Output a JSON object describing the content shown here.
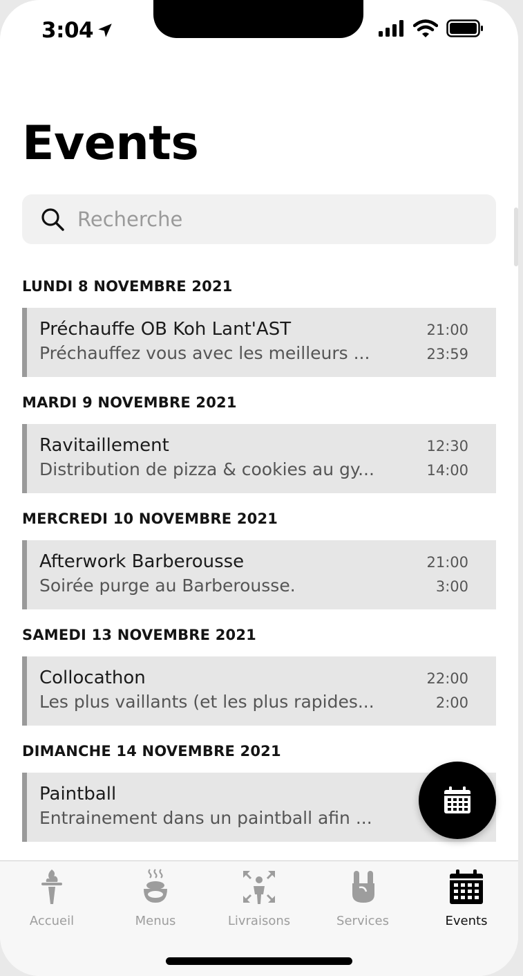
{
  "status_bar": {
    "time": "3:04"
  },
  "page": {
    "title": "Events"
  },
  "search": {
    "placeholder": "Recherche"
  },
  "sections": [
    {
      "date": "LUNDI 8 NOVEMBRE 2021",
      "event": {
        "title": "Préchauffe OB Koh Lant'AST",
        "description": "Préchauffez vous avec les meilleurs ...",
        "start": "21:00",
        "end": "23:59"
      }
    },
    {
      "date": "MARDI 9 NOVEMBRE 2021",
      "event": {
        "title": "Ravitaillement",
        "description": "Distribution de pizza & cookies au gy...",
        "start": "12:30",
        "end": "14:00"
      }
    },
    {
      "date": "MERCREDI 10 NOVEMBRE 2021",
      "event": {
        "title": "Afterwork Barberousse",
        "description": "Soirée purge au Barberousse.",
        "start": "21:00",
        "end": "3:00"
      }
    },
    {
      "date": "SAMEDI 13 NOVEMBRE 2021",
      "event": {
        "title": "Collocathon",
        "description": "Les plus vaillants (et les plus rapides...",
        "start": "22:00",
        "end": "2:00"
      }
    },
    {
      "date": "DIMANCHE 14 NOVEMBRE 2021",
      "event": {
        "title": "Paintball",
        "description": "Entrainement dans un paintball afin ...",
        "start": "",
        "end": ""
      }
    }
  ],
  "tabs": [
    {
      "label": "Accueil",
      "icon": "torch-icon",
      "active": false
    },
    {
      "label": "Menus",
      "icon": "food-bowl-icon",
      "active": false
    },
    {
      "label": "Livraisons",
      "icon": "delivery-icon",
      "active": false
    },
    {
      "label": "Services",
      "icon": "rock-hand-icon",
      "active": false
    },
    {
      "label": "Events",
      "icon": "calendar-icon",
      "active": true
    }
  ],
  "colors": {
    "accent": "#000000",
    "card_background": "#e6e6e6",
    "card_border": "#9a9a9a",
    "tab_inactive": "#9d9d9d",
    "tab_active": "#111111"
  }
}
